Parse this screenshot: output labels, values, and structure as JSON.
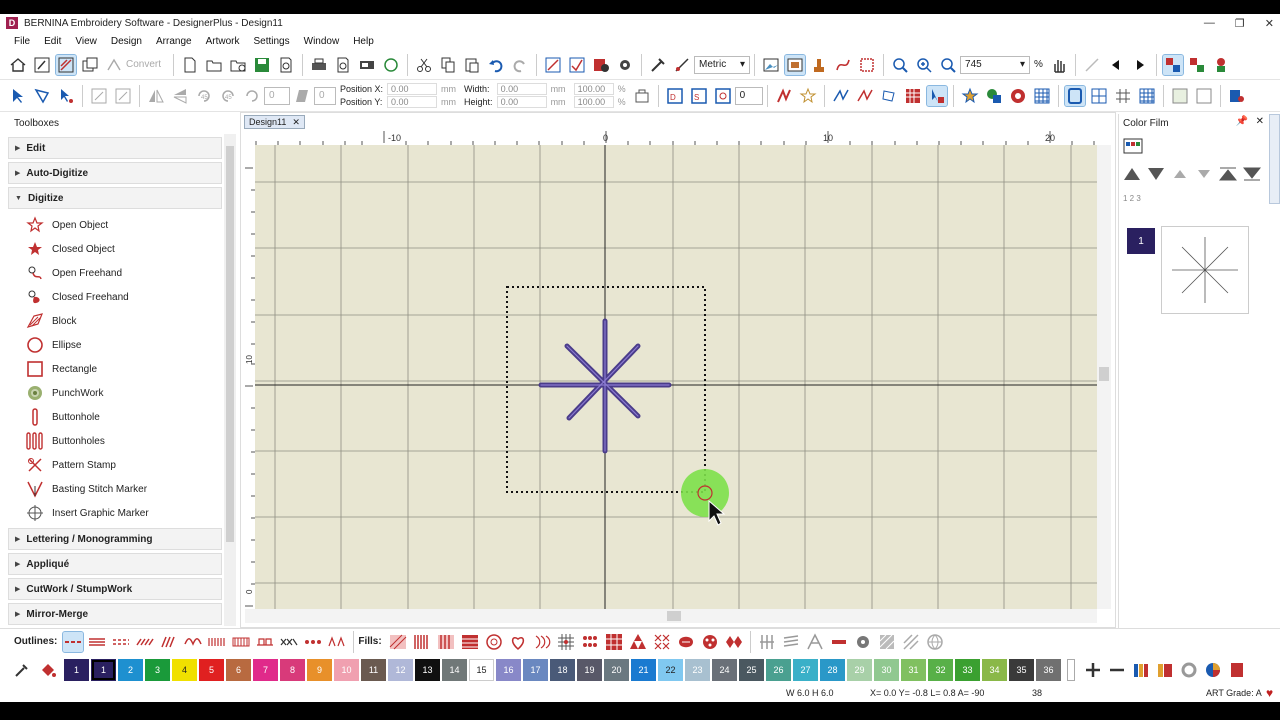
{
  "window": {
    "title": "BERNINA Embroidery Software - DesignerPlus - Design11",
    "logo_letter": "D",
    "controls": [
      "—",
      "❐",
      "✕"
    ]
  },
  "menu": [
    "File",
    "Edit",
    "View",
    "Design",
    "Arrange",
    "Artwork",
    "Settings",
    "Window",
    "Help"
  ],
  "toolbar1": {
    "convert_label": "Convert",
    "units_select": "Metric",
    "zoom_value": "745",
    "zoom_unit": "%"
  },
  "toolbar2": {
    "rotate_angle_1": "45",
    "rotate_angle_2": "45",
    "angle_value": "0",
    "slant_value": "0",
    "pos_x_label": "Position X:",
    "pos_x": "0.00",
    "pos_y_label": "Position Y:",
    "pos_y": "0.00",
    "width_label": "Width:",
    "width": "0.00",
    "height_label": "Height:",
    "height": "0.00",
    "unit_mm": "mm",
    "pct_w": "100.00",
    "pct_h": "100.00",
    "pct": "%",
    "repeat_value": "0"
  },
  "toolboxes": {
    "header": "Toolboxes",
    "groups_top": [
      "Edit",
      "Auto-Digitize",
      "Digitize"
    ],
    "digitize_items": [
      "Open Object",
      "Closed Object",
      "Open Freehand",
      "Closed Freehand",
      "Block",
      "Ellipse",
      "Rectangle",
      "PunchWork",
      "Buttonhole",
      "Buttonholes",
      "Pattern Stamp",
      "Basting Stitch Marker",
      "Insert Graphic Marker"
    ],
    "groups_bottom": [
      "Lettering / Monogramming",
      "Appliqué",
      "CutWork / StumpWork",
      "Mirror-Merge"
    ]
  },
  "document": {
    "tab_label": "Design11",
    "tab_close": "✕",
    "ruler_h_labels": [
      "-10",
      "0",
      "10",
      "20"
    ],
    "ruler_v_labels": [
      "10",
      "0"
    ]
  },
  "colorfilm": {
    "header": "Color Film",
    "pin": "📌",
    "close": "✕",
    "numbers_icon": "1 2 3",
    "item_number": "1"
  },
  "bottom_toolbar": {
    "outlines_label": "Outlines:",
    "fills_label": "Fills:"
  },
  "palette": {
    "colors": [
      {
        "n": "1",
        "c": "#2a2060"
      },
      {
        "n": "1",
        "c": "#2a2060",
        "current": true
      },
      {
        "n": "2",
        "c": "#1e90d0"
      },
      {
        "n": "3",
        "c": "#1a9a3a"
      },
      {
        "n": "4",
        "c": "#f0e000",
        "dark": true
      },
      {
        "n": "5",
        "c": "#e02020"
      },
      {
        "n": "6",
        "c": "#b86a40"
      },
      {
        "n": "7",
        "c": "#e02a8a"
      },
      {
        "n": "8",
        "c": "#d83a7a"
      },
      {
        "n": "9",
        "c": "#e8902a"
      },
      {
        "n": "10",
        "c": "#f0a0b0"
      },
      {
        "n": "11",
        "c": "#6a5a50"
      },
      {
        "n": "12",
        "c": "#b0b8d8"
      },
      {
        "n": "13",
        "c": "#101010"
      },
      {
        "n": "14",
        "c": "#707878"
      },
      {
        "n": "15",
        "c": "#ffffff",
        "dark": true
      },
      {
        "n": "16",
        "c": "#8888c8"
      },
      {
        "n": "17",
        "c": "#6a88c0"
      },
      {
        "n": "18",
        "c": "#4a5a78"
      },
      {
        "n": "19",
        "c": "#585868"
      },
      {
        "n": "20",
        "c": "#6a7880"
      },
      {
        "n": "21",
        "c": "#1a7ad0"
      },
      {
        "n": "22",
        "c": "#80c8f0",
        "dark": true
      },
      {
        "n": "23",
        "c": "#a8c0d0"
      },
      {
        "n": "24",
        "c": "#6a7078"
      },
      {
        "n": "25",
        "c": "#4a5860"
      },
      {
        "n": "26",
        "c": "#4aa090"
      },
      {
        "n": "27",
        "c": "#3ab0c8"
      },
      {
        "n": "28",
        "c": "#2a98c8"
      },
      {
        "n": "29",
        "c": "#a8d0a8"
      },
      {
        "n": "30",
        "c": "#90c890"
      },
      {
        "n": "31",
        "c": "#80c060"
      },
      {
        "n": "32",
        "c": "#58b048"
      },
      {
        "n": "33",
        "c": "#3aa030"
      },
      {
        "n": "34",
        "c": "#8ab848"
      },
      {
        "n": "35",
        "c": "#3a3a3a"
      },
      {
        "n": "36",
        "c": "#707070"
      }
    ]
  },
  "status": {
    "size": "W   6.0 H   6.0",
    "coords": "X=   0.0 Y=  -0.8 L=   0.8 A= -90",
    "count": "38",
    "grade": "ART Grade: A"
  }
}
